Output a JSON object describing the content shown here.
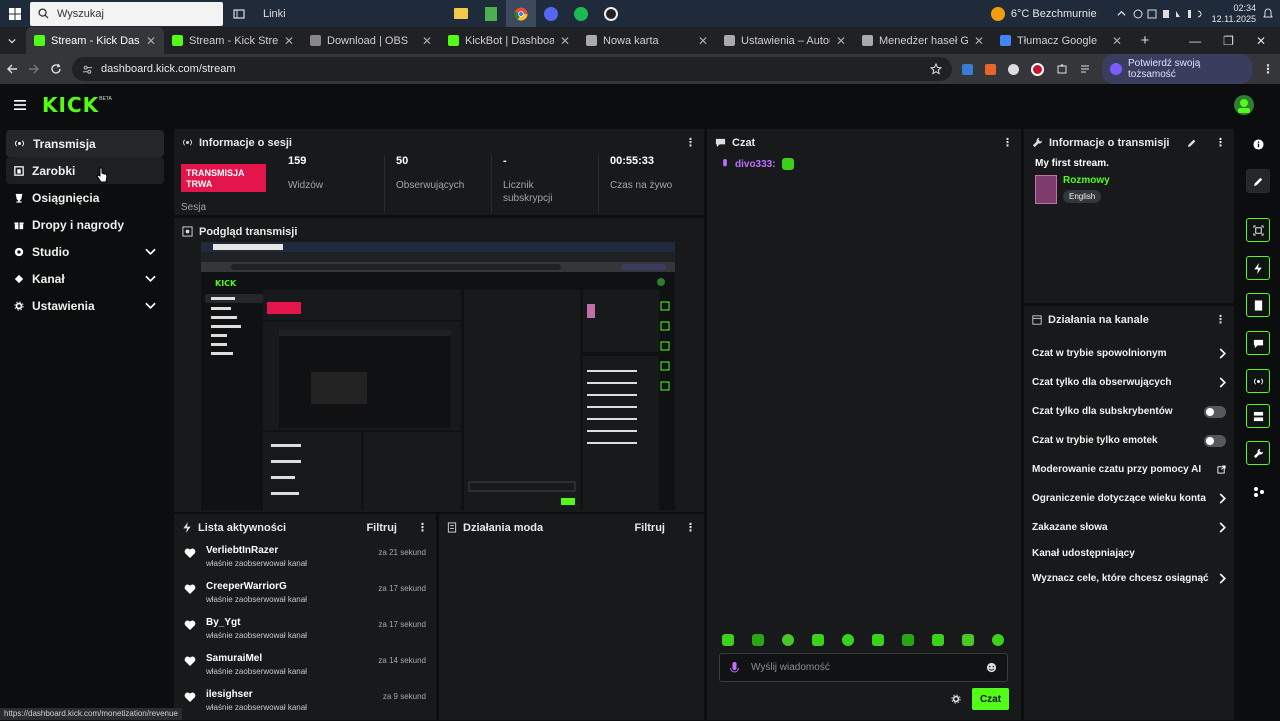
{
  "taskbar": {
    "search_placeholder": "Wyszukaj",
    "links_label": "Linki",
    "weather": "6°C Bezchmurnie",
    "time": "02:34",
    "date": "12.11.2025"
  },
  "browser": {
    "tabs": [
      {
        "title": "Stream - Kick Dashboard",
        "color": "#53fc18",
        "active": true
      },
      {
        "title": "Stream - Kick Streaming",
        "color": "#53fc18"
      },
      {
        "title": "Download | OBS",
        "color": "#888888"
      },
      {
        "title": "KickBot | Dashboard",
        "color": "#53fc18"
      },
      {
        "title": "Nowa karta",
        "color": "#aaaaaa"
      },
      {
        "title": "Ustawienia – Autouzupełn",
        "color": "#aaaaaa"
      },
      {
        "title": "Menedżer haseł Google",
        "color": "#aaaaaa"
      },
      {
        "title": "Tłumacz Google",
        "color": "#4285f4"
      }
    ],
    "url": "dashboard.kick.com/stream",
    "verify_label": "Potwierdź swoją tożsamość"
  },
  "nav": [
    {
      "label": "Transmisja",
      "icon": "broadcast-icon"
    },
    {
      "label": "Zarobki",
      "icon": "earnings-icon"
    },
    {
      "label": "Osiągnięcia",
      "icon": "trophy-icon"
    },
    {
      "label": "Dropy i nagrody",
      "icon": "gift-icon"
    },
    {
      "label": "Studio",
      "icon": "studio-icon",
      "expandable": true
    },
    {
      "label": "Kanał",
      "icon": "channel-icon",
      "expandable": true
    },
    {
      "label": "Ustawienia",
      "icon": "gear-icon",
      "expandable": true
    }
  ],
  "session": {
    "title": "Informacje o sesji",
    "badge": "TRANSMISJA TRWA",
    "session_label": "Sesja",
    "stats": [
      {
        "value": "159",
        "label": "Widzów"
      },
      {
        "value": "50",
        "label": "Obserwujących"
      },
      {
        "value": "-",
        "label": "Licznik subskrypcji"
      },
      {
        "value": "00:55:33",
        "label": "Czas na żywo"
      }
    ]
  },
  "preview": {
    "title": "Podgląd transmisji"
  },
  "activity": {
    "title": "Lista aktywności",
    "filter": "Filtruj",
    "items": [
      {
        "name": "VerliebtInRazer",
        "action": "właśnie zaobserwował kanał",
        "time": "za 21 sekund"
      },
      {
        "name": "CreeperWarriorG",
        "action": "właśnie zaobserwował kanał",
        "time": "za 17 sekund"
      },
      {
        "name": "By_Ygt",
        "action": "właśnie zaobserwował kanał",
        "time": "za 17 sekund"
      },
      {
        "name": "SamuraiMel",
        "action": "właśnie zaobserwował kanał",
        "time": "za 14 sekund"
      },
      {
        "name": "ilesighser",
        "action": "właśnie zaobserwował kanał",
        "time": "za 9 sekund"
      }
    ]
  },
  "mod": {
    "title": "Działania moda",
    "filter": "Filtruj"
  },
  "chat": {
    "title": "Czat",
    "message_user": "divo333:",
    "input_placeholder": "Wyślij wiadomość",
    "send_label": "Czat"
  },
  "stream_info": {
    "title": "Informacje o transmisji",
    "stream_title": "My first stream.",
    "category": "Rozmowy",
    "language": "English"
  },
  "channel_actions": {
    "title": "Działania na kanale",
    "items": [
      {
        "label": "Czat w trybie spowolnionym",
        "control": "chevron"
      },
      {
        "label": "Czat tylko dla obserwujących",
        "control": "chevron"
      },
      {
        "label": "Czat tylko dla subskrybentów",
        "control": "toggle"
      },
      {
        "label": "Czat w trybie tylko emotek",
        "control": "toggle"
      },
      {
        "label": "Moderowanie czatu przy pomocy AI",
        "control": "external"
      },
      {
        "label": "Ograniczenie dotyczące wieku konta",
        "control": "chevron"
      },
      {
        "label": "Zakazane słowa",
        "control": "chevron"
      },
      {
        "label": "Kanał udostępniający",
        "control": "none"
      },
      {
        "label": "Wyznacz cele, które chcesz osiągnąć",
        "control": "chevron"
      }
    ]
  },
  "status_url": "https://dashboard.kick.com/monetization/revenue",
  "colors": {
    "brand": "#53fc18",
    "live": "#e3154b",
    "panel": "#17191b",
    "bg": "#0b0d0e"
  }
}
